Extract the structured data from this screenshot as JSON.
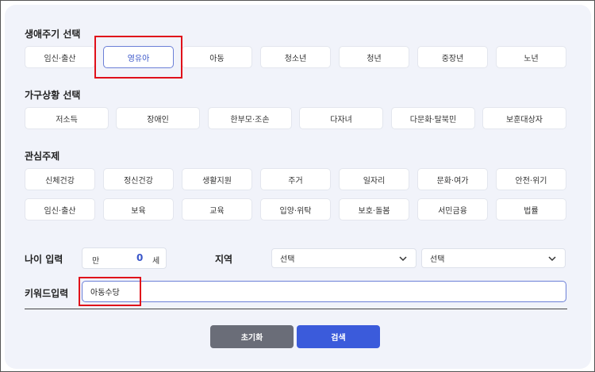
{
  "life_cycle": {
    "title": "생애주기 선택",
    "items": [
      "임신·출산",
      "영유아",
      "아동",
      "청소년",
      "청년",
      "중장년",
      "노년"
    ],
    "selected": "영유아"
  },
  "household": {
    "title": "가구상황 선택",
    "items": [
      "저소득",
      "장애인",
      "한부모·조손",
      "다자녀",
      "다문화·탈북민",
      "보훈대상자"
    ]
  },
  "interest": {
    "title": "관심주제",
    "row1": [
      "신체건강",
      "정신건강",
      "생활지원",
      "주거",
      "일자리",
      "문화·여가",
      "안전·위기"
    ],
    "row2": [
      "임신·출산",
      "보육",
      "교육",
      "입양·위탁",
      "보호·돌봄",
      "서민금융",
      "법률"
    ]
  },
  "age": {
    "label": "나이 입력",
    "prefix": "만",
    "value": "0",
    "suffix": "세"
  },
  "region": {
    "label": "지역",
    "select1": "선택",
    "select2": "선택"
  },
  "keyword": {
    "label": "키워드입력",
    "value": "아동수당"
  },
  "buttons": {
    "reset": "초기화",
    "search": "검색"
  },
  "colors": {
    "accent": "#3b5bdb",
    "highlight": "#e0101a",
    "panel": "#f1f3fa"
  }
}
